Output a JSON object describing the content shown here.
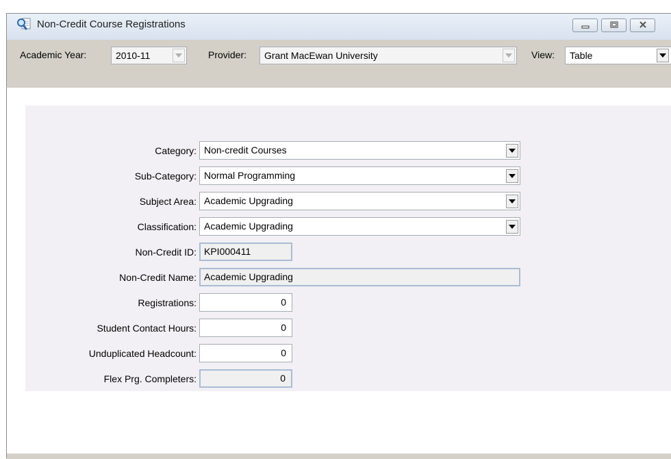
{
  "window": {
    "title": "Non-Credit Course Registrations"
  },
  "toolbar": {
    "academic_year_label": "Academic Year:",
    "academic_year_value": "2010-11",
    "provider_label": "Provider:",
    "provider_value": "Grant MacEwan University",
    "view_label": "View:",
    "view_value": "Table"
  },
  "form": {
    "category_label": "Category:",
    "category_value": "Non-credit Courses",
    "subcategory_label": "Sub-Category:",
    "subcategory_value": "Normal Programming",
    "subject_area_label": "Subject Area:",
    "subject_area_value": "Academic Upgrading",
    "classification_label": "Classification:",
    "classification_value": "Academic Upgrading",
    "noncredit_id_label": "Non-Credit ID:",
    "noncredit_id_value": "KPI000411",
    "noncredit_name_label": "Non-Credit Name:",
    "noncredit_name_value": "Academic Upgrading",
    "registrations_label": "Registrations:",
    "registrations_value": "0",
    "contact_hours_label": "Student Contact Hours:",
    "contact_hours_value": "0",
    "headcount_label": "Unduplicated Headcount:",
    "headcount_value": "0",
    "completers_label": "Flex Prg. Completers:",
    "completers_value": "0"
  },
  "icons": {
    "app": "search-document-icon",
    "minimize": "minimize-icon",
    "restore": "restore-icon",
    "close": "close-icon",
    "dropdown": "chevron-down-icon"
  }
}
